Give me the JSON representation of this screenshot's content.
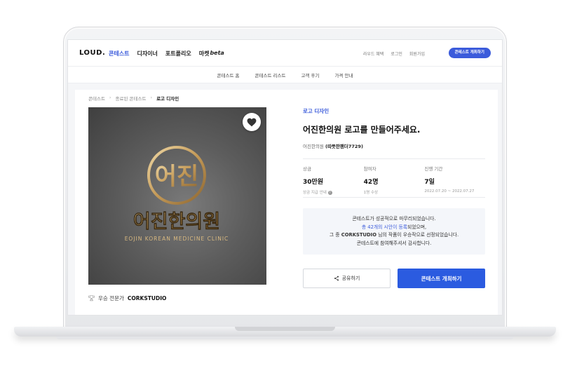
{
  "header": {
    "logo": "LOUD.",
    "nav": [
      {
        "label": "콘테스트",
        "active": true
      },
      {
        "label": "디자이너",
        "active": false
      },
      {
        "label": "포트폴리오",
        "active": false
      },
      {
        "label": "마켓",
        "active": false
      }
    ],
    "market_badge": "beta",
    "util": [
      "라우드 혜택",
      "로그인",
      "회원가입"
    ],
    "host_button": "콘테스트 개최하기"
  },
  "subnav": [
    "콘테스트 홈",
    "콘테스트 리스트",
    "고객 후기",
    "가격 안내"
  ],
  "breadcrumb": [
    "콘테스트",
    "종료된 콘테스트",
    "로고 디자인"
  ],
  "contest": {
    "category": "로고 디자인",
    "title": "어진한의원 로고를 만들어주세요.",
    "org_name": "어진한의원",
    "org_user": "(따뜻한팬더7729)",
    "stats": [
      {
        "key": "상금",
        "value": "30만원",
        "sub": "상금 지급 안내"
      },
      {
        "key": "참여자",
        "value": "42명",
        "sub": "1명 수상"
      },
      {
        "key": "진행 기간",
        "value": "7일",
        "sub": "2022.07.20 ~ 2022.07.27"
      }
    ]
  },
  "logo_image": {
    "mark": "어진",
    "name_ko": "어진한의원",
    "name_en": "EOJIN KOREAN MEDICINE CLINIC"
  },
  "expert": {
    "label": "우승 전문가",
    "name": "CORKSTUDIO"
  },
  "notice": {
    "line1": "콘테스트가 성공적으로 마무리되었습니다.",
    "line2_hl": "총 42개의 시안이 등록",
    "line2_rest": "되었으며,",
    "line3_a": "그 중 ",
    "line3_b": "CORKSTUDIO",
    "line3_c": " 님의 작품이 우승작으로 선정되었습니다.",
    "line4": "콘테스트에 참여해주셔서 감사합니다."
  },
  "buttons": {
    "share": "공유하기",
    "host": "콘테스트 개최하기"
  },
  "colors": {
    "accent": "#3b5bdb",
    "primary_button": "#2b5be0",
    "gold": "#c9a46a"
  }
}
